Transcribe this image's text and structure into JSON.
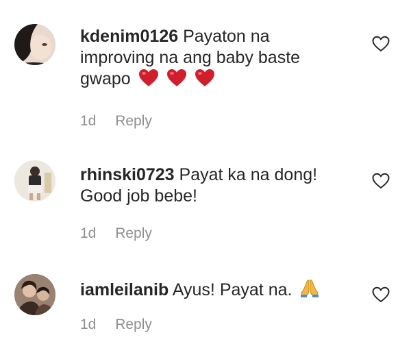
{
  "colors": {
    "text": "#262626",
    "meta": "#8e8e8e",
    "heart_emoji": "#d11e2c",
    "like_outline": "#262626"
  },
  "comments": [
    {
      "username": "kdenim0126",
      "text": "Payaton na improving na ang baby baste gwapo",
      "emoji": "red-heart x3",
      "time": "1d",
      "reply_label": "Reply",
      "like_icon": "heart-outline-icon"
    },
    {
      "username": "rhinski0723",
      "text": "Payat ka na dong! Good job bebe!",
      "time": "1d",
      "reply_label": "Reply",
      "like_icon": "heart-outline-icon"
    },
    {
      "username": "iamleilanib",
      "text": "Ayus! Payat na.",
      "emoji": "folded-hands",
      "time": "1d",
      "reply_label": "Reply",
      "like_icon": "heart-outline-icon"
    }
  ]
}
